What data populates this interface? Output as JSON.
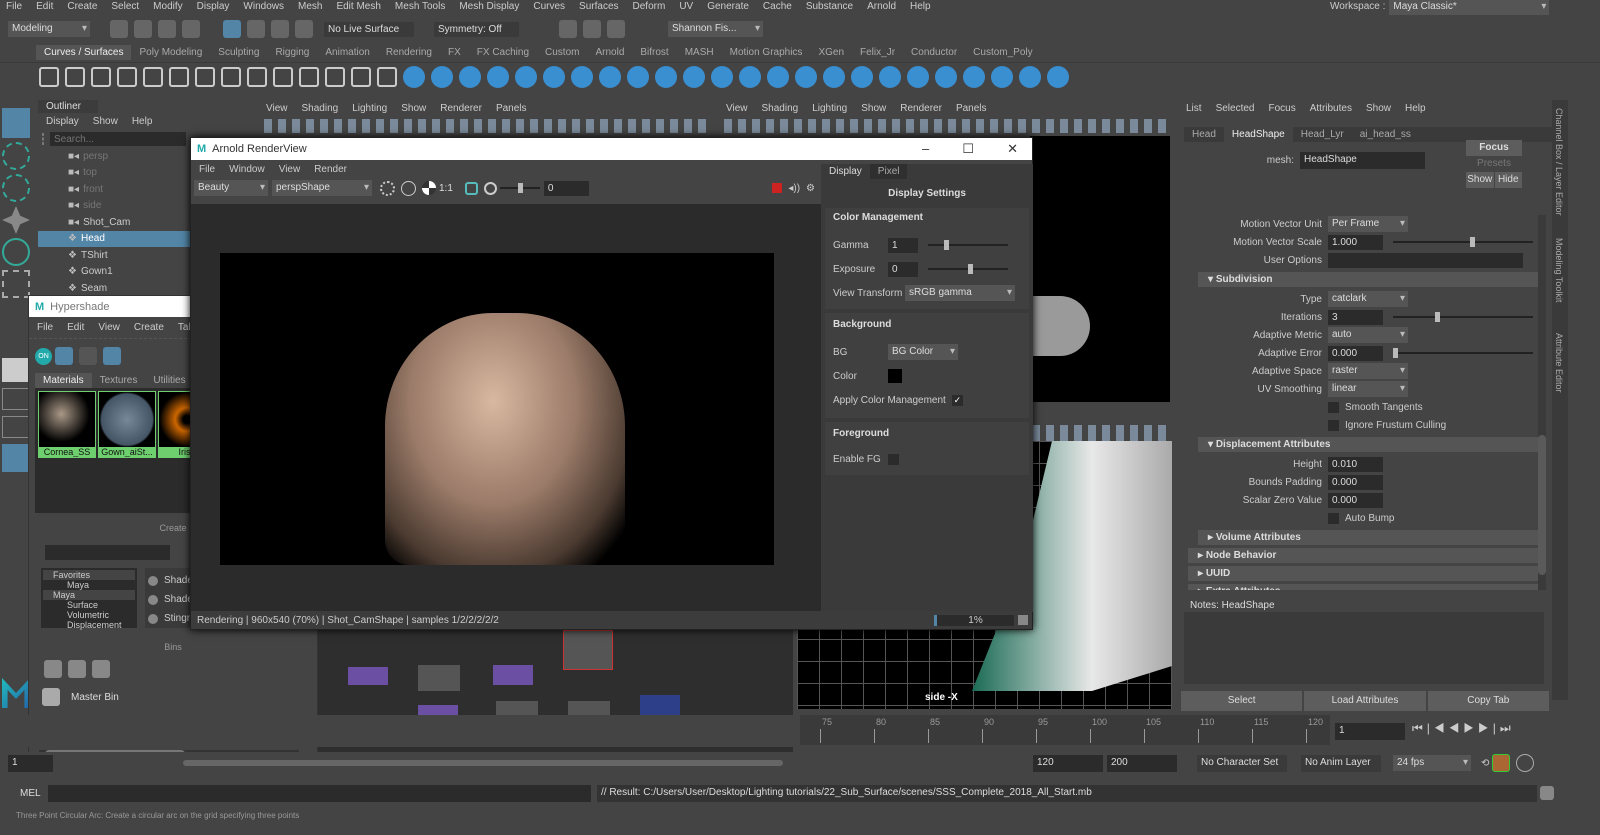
{
  "menubar": [
    "File",
    "Edit",
    "Create",
    "Select",
    "Modify",
    "Display",
    "Windows",
    "Mesh",
    "Edit Mesh",
    "Mesh Tools",
    "Mesh Display",
    "Curves",
    "Surfaces",
    "Deform",
    "UV",
    "Generate",
    "Cache",
    "Substance",
    "Arnold",
    "Help"
  ],
  "workspace": {
    "label": "Workspace :",
    "value": "Maya Classic*"
  },
  "status": {
    "mode": "Modeling",
    "live_surface": "No Live Surface",
    "symmetry": "Symmetry: Off",
    "user": "Shannon Fis..."
  },
  "shelf_tabs": [
    "Curves / Surfaces",
    "Poly Modeling",
    "Sculpting",
    "Rigging",
    "Animation",
    "Rendering",
    "FX",
    "FX Caching",
    "Custom",
    "Arnold",
    "Bifrost",
    "MASH",
    "Motion Graphics",
    "XGen",
    "Felix_Jr",
    "Conductor",
    "Custom_Poly"
  ],
  "outliner": {
    "title": "Outliner",
    "menu": [
      "Display",
      "Show",
      "Help"
    ],
    "search_placeholder": "Search...",
    "items": [
      "persp",
      "top",
      "front",
      "side",
      "Shot_Cam",
      "Head",
      "TShirt",
      "Gown1",
      "Seam"
    ]
  },
  "hypershade": {
    "title": "Hypershade",
    "menu": [
      "File",
      "Edit",
      "View",
      "Create",
      "Tabs"
    ],
    "tabs": [
      "Materials",
      "Textures",
      "Utilities"
    ],
    "materials": [
      "Cornea_SS",
      "Gown_aiSt...",
      "Iris_"
    ],
    "create_label": "Create",
    "tree": [
      "Favorites",
      "Maya",
      "Maya",
      "Surface",
      "Volumetric",
      "Displacement"
    ],
    "shaders": [
      "Shade",
      "Shade",
      "Stingray PBS"
    ],
    "bins_label": "Bins",
    "master_bin": "Master Bin"
  },
  "viewport_menu": [
    "View",
    "Shading",
    "Lighting",
    "Show",
    "Renderer",
    "Panels"
  ],
  "side_view_label": "side -X",
  "renderview": {
    "title": "Arnold RenderView",
    "menu": [
      "File",
      "Window",
      "View",
      "Render"
    ],
    "aov": "Beauty",
    "camera": "perspShape",
    "ratio": "1:1",
    "exposure_field": "0",
    "tabs": [
      "Display",
      "Pixel"
    ],
    "panel_title": "Display Settings",
    "color_mgmt": "Color Management",
    "gamma_label": "Gamma",
    "gamma": "1",
    "exposure_label": "Exposure",
    "exposure": "0",
    "view_transform_label": "View Transform",
    "view_transform": "sRGB gamma",
    "background": "Background",
    "bg_label": "BG",
    "bg": "BG Color",
    "color_label": "Color",
    "apply_cm": "Apply Color Management",
    "foreground": "Foreground",
    "enable_fg": "Enable FG",
    "status": "Rendering | 960x540 (70%) | Shot_CamShape  | samples 1/2/2/2/2/2",
    "progress": "1%"
  },
  "attr_editor": {
    "menu": [
      "List",
      "Selected",
      "Focus",
      "Attributes",
      "Show",
      "Help"
    ],
    "tabs": [
      "Head",
      "HeadShape",
      "Head_Lyr",
      "ai_head_ss"
    ],
    "mesh_label": "mesh:",
    "mesh": "HeadShape",
    "focus": "Focus",
    "presets": "Presets",
    "show": "Show",
    "hide": "Hide",
    "rows": [
      {
        "label": "Motion Vector Unit",
        "value": "Per Frame"
      },
      {
        "label": "Motion Vector Scale",
        "value": "1.000"
      },
      {
        "label": "User Options",
        "value": ""
      }
    ],
    "subdivision": "Subdivision",
    "sub_rows": [
      {
        "label": "Type",
        "value": "catclark"
      },
      {
        "label": "Iterations",
        "value": "3"
      },
      {
        "label": "Adaptive Metric",
        "value": "auto"
      },
      {
        "label": "Adaptive Error",
        "value": "0.000"
      },
      {
        "label": "Adaptive Space",
        "value": "raster"
      },
      {
        "label": "UV Smoothing",
        "value": "linear"
      }
    ],
    "smooth_tangents": "Smooth Tangents",
    "ignore_frustum": "Ignore Frustum Culling",
    "displacement": "Displacement Attributes",
    "disp_rows": [
      {
        "label": "Height",
        "value": "0.010"
      },
      {
        "label": "Bounds Padding",
        "value": "0.000"
      },
      {
        "label": "Scalar Zero Value",
        "value": "0.000"
      }
    ],
    "auto_bump": "Auto Bump",
    "collapsed": [
      "Volume Attributes",
      "Node Behavior",
      "UUID",
      "Extra Attributes"
    ],
    "notes": "Notes:  HeadShape",
    "buttons": [
      "Select",
      "Load Attributes",
      "Copy Tab"
    ]
  },
  "side_tabs": [
    "Channel Box / Layer Editor",
    "Modeling Toolkit",
    "Attribute Editor"
  ],
  "timeline": {
    "ticks": [
      "75",
      "80",
      "85",
      "90",
      "95",
      "100",
      "105",
      "110",
      "115",
      "120"
    ],
    "current": "1",
    "start": "1",
    "end_a": "120",
    "end_b": "200",
    "char_set": "No Character Set",
    "anim_layer": "No Anim Layer",
    "fps": "24 fps"
  },
  "cmdline": {
    "label": "MEL",
    "result": "// Result: C:/Users/User/Desktop/Lighting tutorials/22_Sub_Surface/scenes/SSS_Complete_2018_All_Start.mb"
  },
  "helpline": "Three Point Circular Arc: Create a circular arc on the grid specifying three points",
  "colors": {
    "accent": "#5285a6",
    "material_label": "#6ecf6e",
    "wire": "#3fe0b0"
  }
}
